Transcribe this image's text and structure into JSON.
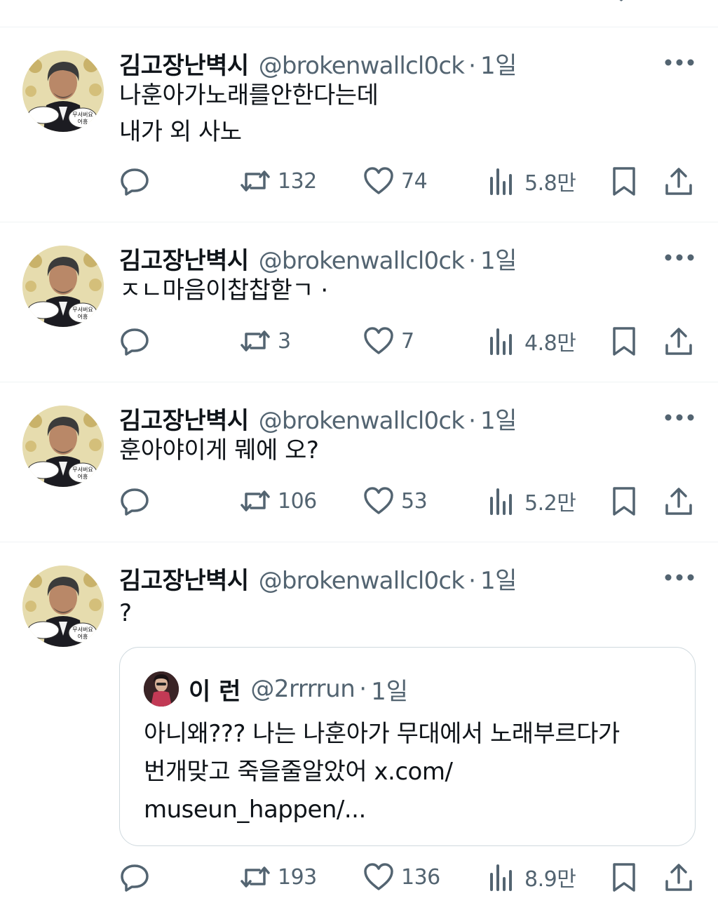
{
  "tweets": [
    {
      "name": "김고장난벽시",
      "handle": "@brokenwallcl0ck",
      "dot": "·",
      "time": "1일",
      "text": "나훈아가노래를안한다는데\n내가 외 사노",
      "replies": "",
      "retweets": "132",
      "likes": "74",
      "views": "5.8만",
      "avatar_text": [
        "무서버요",
        "어흥"
      ]
    },
    {
      "name": "김고장난벽시",
      "handle": "@brokenwallcl0ck",
      "dot": "·",
      "time": "1일",
      "text": "ㅈㄴ마음이찹찹핟ㄱ ·",
      "replies": "",
      "retweets": "3",
      "likes": "7",
      "views": "4.8만",
      "avatar_text": [
        "무서버요",
        "어흥"
      ]
    },
    {
      "name": "김고장난벽시",
      "handle": "@brokenwallcl0ck",
      "dot": "·",
      "time": "1일",
      "text": "훈아야이게 뭬에 오?",
      "replies": "",
      "retweets": "106",
      "likes": "53",
      "views": "5.2만",
      "avatar_text": [
        "무서버요",
        "어흥"
      ]
    },
    {
      "name": "김고장난벽시",
      "handle": "@brokenwallcl0ck",
      "dot": "·",
      "time": "1일",
      "text": "?",
      "replies": "",
      "retweets": "193",
      "likes": "136",
      "views": "8.9만",
      "avatar_text": [
        "무서버요",
        "어흥"
      ]
    }
  ],
  "quote": {
    "name": "이 런",
    "handle": "@2rrrrun",
    "dot": "·",
    "time": "1일",
    "text": "아니왜??? 나는 나훈아가 무대에서 노래부르다가\n번개맞고 죽을줄알았어 x.com/\nmuseun_happen/..."
  },
  "icons": {
    "reply": "reply-icon",
    "retweet": "retweet-icon",
    "like": "heart-icon",
    "views": "views-chart-icon",
    "bookmark": "bookmark-icon",
    "share": "share-icon",
    "more": "more-dots-icon"
  },
  "colors": {
    "text": "#0f1419",
    "secondary": "#536471",
    "divider": "#eff3f4",
    "quote_border": "#cfd9de"
  }
}
